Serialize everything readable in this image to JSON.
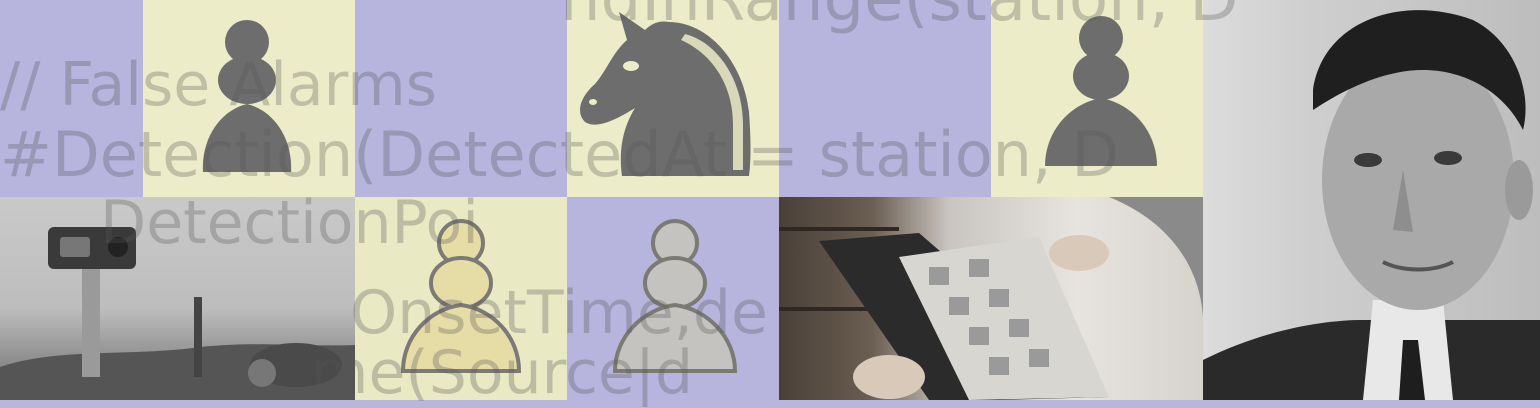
{
  "image": {
    "palette": {
      "lavender": "#b7b5dd",
      "cream": "#ececc8",
      "dark_piece": "#6d6d6d",
      "light_piece_yellow": "#e6dca6",
      "light_piece_grey": "#c4c3c0",
      "piece_outline": "#7b7a75"
    },
    "background_code_lines": [
      "ndInRange(station, D",
      "// False Alarms",
      "#Detection(DetectedAt = station, D",
      "DetectionPoi",
      "OnsetTime,de",
      "me(Source|d"
    ],
    "tiles": [
      {
        "name": "pawn-dark-icon"
      },
      {
        "name": "knight-dark-icon"
      },
      {
        "name": "pawn-dark-icon"
      },
      {
        "name": "rover-photo"
      },
      {
        "name": "pawn-light-yellow-icon"
      },
      {
        "name": "pawn-light-grey-icon"
      },
      {
        "name": "reader-with-book-photo"
      },
      {
        "name": "man-portrait-photo"
      }
    ]
  }
}
